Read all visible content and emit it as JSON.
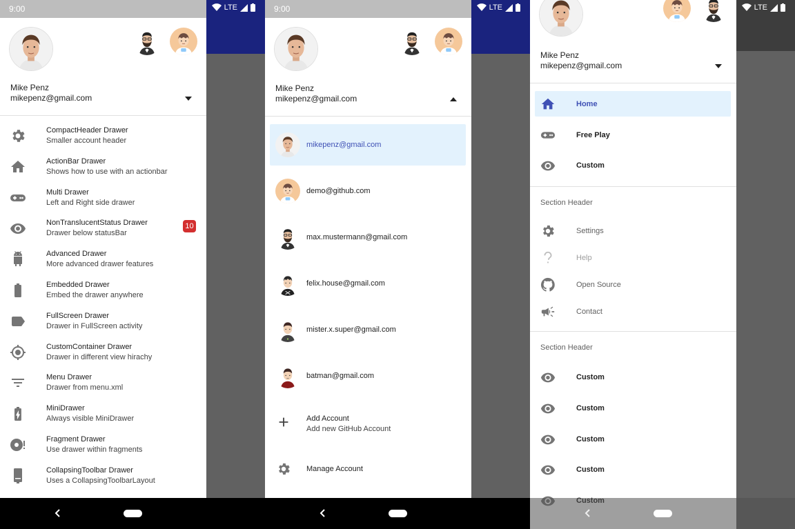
{
  "status_bar": {
    "time": "9:00",
    "network": "LTE"
  },
  "account": {
    "name": "Mike Penz",
    "email": "mikepenz@gmail.com"
  },
  "screen1": {
    "items": [
      {
        "title": "CompactHeader Drawer",
        "subtitle": "Smaller account header",
        "icon": "gear-icon"
      },
      {
        "title": "ActionBar Drawer",
        "subtitle": "Shows how to use with an actionbar",
        "icon": "home-icon"
      },
      {
        "title": "Multi Drawer",
        "subtitle": "Left and Right side drawer",
        "icon": "gamepad-icon"
      },
      {
        "title": "NonTranslucentStatus Drawer",
        "subtitle": "Drawer below statusBar",
        "icon": "eye-icon",
        "badge": "10"
      },
      {
        "title": "Advanced Drawer",
        "subtitle": "More advanced drawer features",
        "icon": "android-icon"
      },
      {
        "title": "Embedded Drawer",
        "subtitle": "Embed the drawer anywhere",
        "icon": "battery-icon"
      },
      {
        "title": "FullScreen Drawer",
        "subtitle": "Drawer in FullScreen activity",
        "icon": "label-icon"
      },
      {
        "title": "CustomContainer Drawer",
        "subtitle": "Drawer in different view hirachy",
        "icon": "gps-icon"
      },
      {
        "title": "Menu Drawer",
        "subtitle": "Drawer from menu.xml",
        "icon": "filter-icon"
      },
      {
        "title": "MiniDrawer",
        "subtitle": "Always visible MiniDrawer",
        "icon": "battery-charging-icon"
      },
      {
        "title": "Fragment Drawer",
        "subtitle": "Use drawer within fragments",
        "icon": "disc-alert-icon"
      },
      {
        "title": "CollapsingToolbar Drawer",
        "subtitle": "Uses a CollapsingToolbarLayout",
        "icon": "device-icon"
      }
    ]
  },
  "screen2": {
    "accounts": [
      {
        "email": "mikepenz@gmail.com",
        "avatar": "mike-avatar",
        "selected": true
      },
      {
        "email": "demo@github.com",
        "avatar": "demo-avatar"
      },
      {
        "email": "max.mustermann@gmail.com",
        "avatar": "max-avatar"
      },
      {
        "email": "felix.house@gmail.com",
        "avatar": "felix-avatar"
      },
      {
        "email": "mister.x.super@gmail.com",
        "avatar": "misterx-avatar"
      },
      {
        "email": "batman@gmail.com",
        "avatar": "batman-avatar"
      }
    ],
    "add_account": {
      "title": "Add Account",
      "subtitle": "Add new GitHub Account"
    },
    "manage_account": "Manage Account"
  },
  "screen3": {
    "primary": [
      {
        "label": "Home",
        "icon": "home-icon",
        "selected": true
      },
      {
        "label": "Free Play",
        "icon": "gamepad-icon"
      },
      {
        "label": "Custom",
        "icon": "eye-icon"
      }
    ],
    "section1": "Section Header",
    "secondary": [
      {
        "label": "Settings",
        "icon": "gear-icon"
      },
      {
        "label": "Help",
        "icon": "help-icon",
        "disabled": true
      },
      {
        "label": "Open Source",
        "icon": "github-icon"
      },
      {
        "label": "Contact",
        "icon": "megaphone-icon"
      }
    ],
    "section2": "Section Header",
    "custom": [
      "Custom",
      "Custom",
      "Custom",
      "Custom",
      "Custom"
    ]
  },
  "colors": {
    "accent": "#3f51b5",
    "highlight": "#e3f2fd",
    "app_bar": "#1a237e",
    "badge": "#d32f2f"
  }
}
